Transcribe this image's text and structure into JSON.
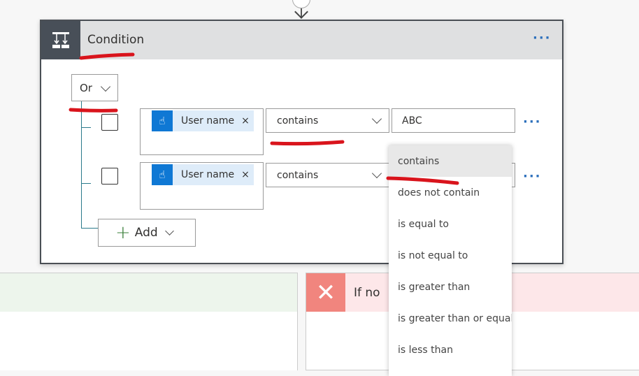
{
  "condition": {
    "title": "Condition",
    "group_operator": "Or",
    "more": "···",
    "rows": [
      {
        "token": "User name",
        "token_remove": "×",
        "operator": "contains",
        "value": "ABC",
        "more": "···"
      },
      {
        "token": "User name",
        "token_remove": "×",
        "operator": "contains",
        "value": "",
        "more": "···"
      }
    ],
    "add_label": "Add"
  },
  "branches": {
    "yes": {
      "label": ""
    },
    "no": {
      "label": "If no",
      "icon": "close-icon"
    }
  },
  "dropdown": {
    "options": [
      "contains",
      "does not contain",
      "is equal to",
      "is not equal to",
      "is greater than",
      "is greater than or equal to",
      "is less than"
    ],
    "selected": "contains"
  },
  "colors": {
    "accent": "#0f78d4",
    "header": "#dfe0e1",
    "no_branch": "#fde7e9",
    "no_icon": "#f1857e",
    "yes_branch": "#edf5ec",
    "annotation": "#d9141c"
  }
}
